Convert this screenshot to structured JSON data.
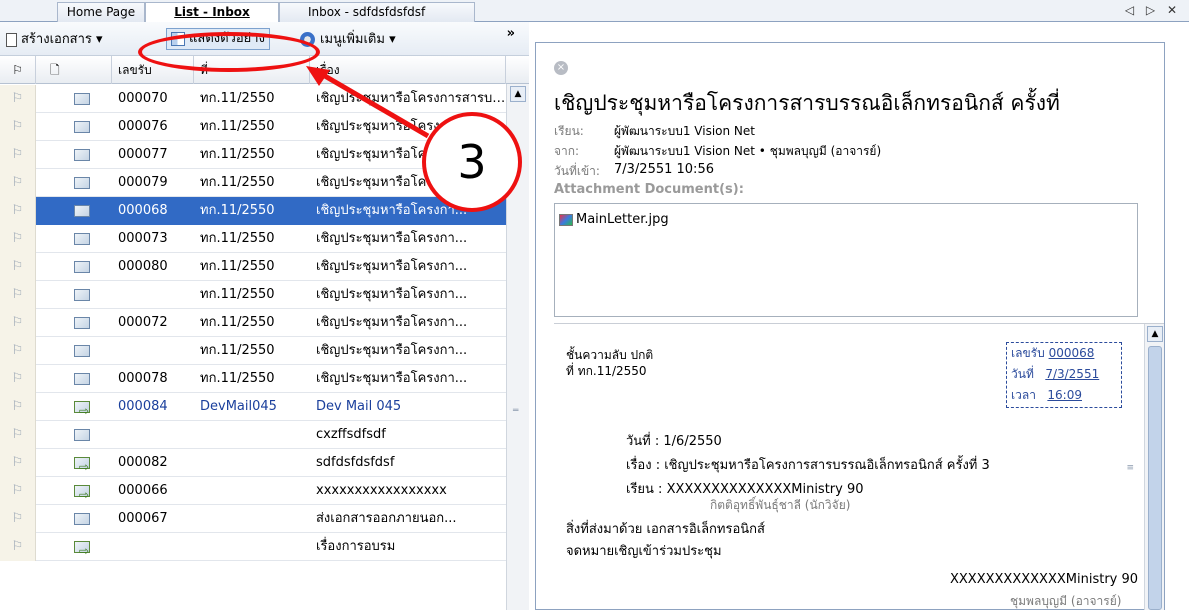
{
  "tabs": [
    {
      "label": "Home Page",
      "active": false
    },
    {
      "label": "List - Inbox",
      "active": true
    },
    {
      "label": "Inbox - sdfdsfdsfdsf",
      "active": false
    }
  ],
  "window_controls": "◁ ▷ ✕",
  "toolbar": {
    "create_label": "สร้างเอกสาร",
    "preview_label": "แสดงตัวอย่าง",
    "more_label": "เมนูเพิ่มเติม",
    "dropdown": "▾",
    "overflow": "»"
  },
  "columns": {
    "flag": "⚐",
    "doc": "🗋",
    "number": "เลขรับ",
    "ref": "ที่",
    "subject": "เรื่อง"
  },
  "rows": [
    {
      "number": "000070",
      "ref": "ทก.11/2550",
      "subject": "เชิญประชุมหารือโครงการสารบรรณ",
      "icon": "open"
    },
    {
      "number": "000076",
      "ref": "ทก.11/2550",
      "subject": "เชิญประชุมหารือโครงการสารบรรณ",
      "icon": "open"
    },
    {
      "number": "000077",
      "ref": "ทก.11/2550",
      "subject": "เชิญประชุมหารือโครงการสารบรรณ",
      "icon": "open"
    },
    {
      "number": "000079",
      "ref": "ทก.11/2550",
      "subject": "เชิญประชุมหารือโครงกา...",
      "icon": "open"
    },
    {
      "number": "000068",
      "ref": "ทก.11/2550",
      "subject": "เชิญประชุมหารือโครงกา...",
      "icon": "open",
      "selected": true
    },
    {
      "number": "000073",
      "ref": "ทก.11/2550",
      "subject": "เชิญประชุมหารือโครงกา...",
      "icon": "open"
    },
    {
      "number": "000080",
      "ref": "ทก.11/2550",
      "subject": "เชิญประชุมหารือโครงกา...",
      "icon": "open"
    },
    {
      "number": "",
      "ref": "ทก.11/2550",
      "subject": "เชิญประชุมหารือโครงกา...",
      "icon": "closed"
    },
    {
      "number": "000072",
      "ref": "ทก.11/2550",
      "subject": "เชิญประชุมหารือโครงกา...",
      "icon": "open"
    },
    {
      "number": "",
      "ref": "ทก.11/2550",
      "subject": "เชิญประชุมหารือโครงกา...",
      "icon": "closed"
    },
    {
      "number": "000078",
      "ref": "ทก.11/2550",
      "subject": "เชิญประชุมหารือโครงกา...",
      "icon": "open"
    },
    {
      "number": "000084",
      "ref": "DevMail045",
      "subject": "Dev Mail 045",
      "icon": "forward",
      "blue": true
    },
    {
      "number": "",
      "ref": "",
      "subject": "cxzffsdfsdf",
      "icon": "closed"
    },
    {
      "number": "000082",
      "ref": "",
      "subject": "sdfdsfdsfdsf",
      "icon": "forward"
    },
    {
      "number": "000066",
      "ref": "",
      "subject": "xxxxxxxxxxxxxxxxx",
      "icon": "forward"
    },
    {
      "number": "000067",
      "ref": "",
      "subject": "ส่งเอกสารออกภายนอก...",
      "icon": "open"
    },
    {
      "number": "",
      "ref": "",
      "subject": "เรื่องการอบรม",
      "icon": "forward"
    }
  ],
  "annotation": {
    "step_number": "3"
  },
  "reading_pane": {
    "close_glyph": "×",
    "title": "เชิญประชุมหารือโครงการสารบรรณอิเล็กทรอนิกส์ ครั้งที่",
    "to_label": "เรียน:",
    "to_value": "ผู้พัฒนาระบบ1 Vision Net",
    "from_label": "จาก:",
    "from_value": "ผู้พัฒนาระบบ1 Vision Net • ชุมพลบุญมี (อาจารย์)",
    "date_label": "วันที่เข้า:",
    "date_value": "7/3/2551 10:56",
    "attachment_label": "Attachment Document(s):",
    "attachment_file": "MainLetter.jpg"
  },
  "letter": {
    "classification": "ชั้นความลับ ปกติ",
    "ref_no": "ที่ ทก.11/2550",
    "recv_number_label": "เลขรับ",
    "recv_number": "000068",
    "recv_date_label": "วันที่",
    "recv_date": "7/3/2551",
    "recv_time_label": "เวลา",
    "recv_time": "16:09",
    "date_line": "วันที่ : 1/6/2550",
    "subject_line": "เรื่อง : เชิญประชุมหารือโครงการสารบรรณอิเล็กทรอนิกส์ ครั้งที่ 3",
    "to_line": "เรียน : XXXXXXXXXXXXXXMinistry 90",
    "to_sub": "กิตติอุทธิ์พันธุ์ชาลี (นักวิจัย)",
    "enclosure_line": "สิ่งที่ส่งมาด้วย เอกสารอิเล็กทรอนิกส์",
    "invitation_line": "จดหมายเชิญเข้าร่วมประชุม",
    "sign_line": "XXXXXXXXXXXXXMinistry 90",
    "sign_sub": "ชุมพลบุญมี (อาจารย์)"
  }
}
